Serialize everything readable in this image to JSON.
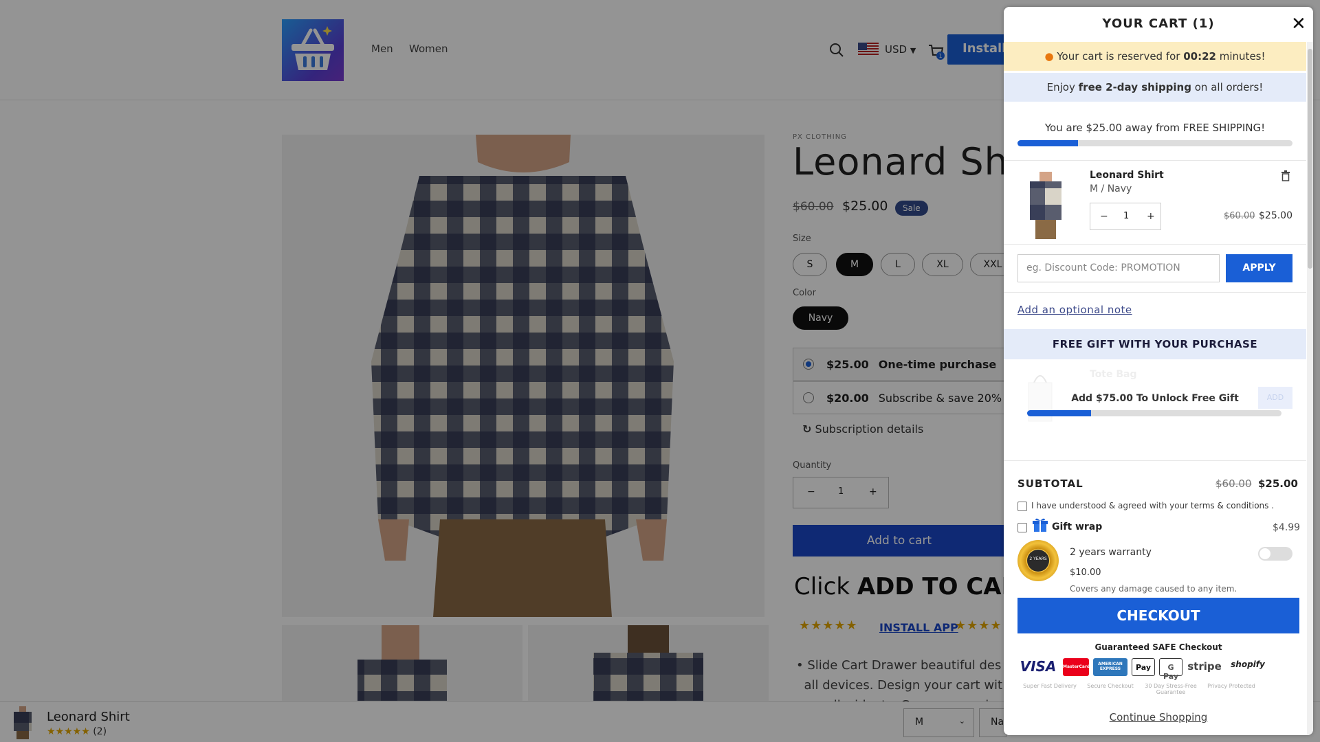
{
  "header": {
    "nav": [
      "Men",
      "Women"
    ],
    "currency": "USD",
    "cart_count": "1",
    "install_label": "Install A"
  },
  "product": {
    "vendor": "PX CLOTHING",
    "title": "Leonard Shi",
    "old_price": "$60.00",
    "price": "$25.00",
    "sale_badge": "Sale",
    "size_label": "Size",
    "sizes": [
      "S",
      "M",
      "L",
      "XL",
      "XXL"
    ],
    "selected_size": "M",
    "color_label": "Color",
    "color": "Navy",
    "purchase_options": [
      {
        "price": "$25.00",
        "label": "One-time purchase",
        "selected": true
      },
      {
        "price": "$20.00",
        "label": "Subscribe & save 20%",
        "selected": false
      }
    ],
    "subscription_details": "Subscription details",
    "quantity_label": "Quantity",
    "quantity": "1",
    "add_to_cart": "Add to cart",
    "click_prefix": "Click ",
    "click_bold": "ADD TO CART",
    "stars": "★★★★★",
    "install_link": "INSTALL APP",
    "desc_line1": "Slide Cart Drawer beautiful design",
    "desc_line2": "all devices. Design your cart with",
    "desc_line3": "upsell widgets. Grow conversion"
  },
  "sticky": {
    "name": "Leonard Shirt",
    "stars": "★★★★★",
    "count": "(2)",
    "size": "M",
    "color": "Na"
  },
  "cart": {
    "title": "YOUR CART (1)",
    "reserved_prefix": "Your cart is reserved for ",
    "reserved_time": "00:22",
    "reserved_suffix": " minutes!",
    "enjoy_prefix": "Enjoy ",
    "enjoy_bold": "free 2-day shipping",
    "enjoy_suffix": " on all orders!",
    "away_text": "You are $25.00 away from FREE SHIPPING!",
    "shipping_progress": 0.22,
    "item": {
      "name": "Leonard Shirt",
      "variant": "M / Navy",
      "qty": "1",
      "old_price": "$60.00",
      "price": "$25.00"
    },
    "discount_placeholder": "eg. Discount Code: PROMOTION",
    "apply_label": "APPLY",
    "note_link": "Add an optional note",
    "gift_header": "FREE GIFT WITH YOUR PURCHASE",
    "gift_name": "Tote Bag",
    "gift_unlock": "Add $75.00 To Unlock Free Gift",
    "gift_add": "ADD",
    "gift_progress": 0.25,
    "subtotal_label": "SUBTOTAL",
    "subtotal_old": "$60.00",
    "subtotal_new": "$25.00",
    "terms_prefix": "I have understood & agreed with your ",
    "terms_link": "terms & conditions",
    "terms_suffix": " .",
    "gift_wrap_label": "Gift wrap",
    "gift_wrap_price": "$4.99",
    "warranty_badge": "2 YEARS",
    "warranty_label": "2 years warranty",
    "warranty_price": "$10.00",
    "warranty_desc": "Covers any damage caused to any item.",
    "checkout_label": "CHECKOUT",
    "guaranteed": "Guaranteed SAFE Checkout",
    "payments": [
      "VISA",
      "MasterCard",
      "AMERICAN EXPRESS",
      "Pay",
      "G Pay",
      "stripe",
      "shopify"
    ],
    "trust_badges": [
      "Super Fast Delivery",
      "Secure Checkout",
      "30 Day Stress-Free Guarantee",
      "Privacy Protected"
    ],
    "continue_label": "Continue Shopping"
  },
  "colors": {
    "primary": "#1a5fd6",
    "reserve_bg": "#fcedc1",
    "info_bg": "#e4ebf9",
    "sale_badge": "#324a8c"
  }
}
